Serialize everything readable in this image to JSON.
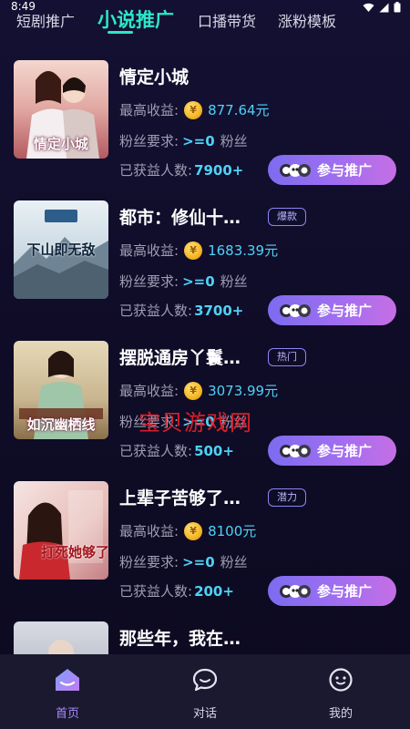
{
  "status_bar": {
    "time": "8:49"
  },
  "top_tabs": [
    {
      "label": "短剧推广",
      "active": false
    },
    {
      "label": "小说推广",
      "active": true
    },
    {
      "label": "口播带货",
      "active": false
    },
    {
      "label": "涨粉模板",
      "active": false
    }
  ],
  "labels": {
    "max_earning": "最高收益:",
    "fans_requirement": "粉丝要求:",
    "fans_unit": "粉丝",
    "earned_count": "已获益人数:",
    "promote_button": "参与推广"
  },
  "books": [
    {
      "title": "情定小城",
      "badge": "",
      "cover_text": "情定小城",
      "max_earning": "877.64元",
      "fans_requirement": ">=0",
      "earned_count": "7900+"
    },
    {
      "title": "都市：修仙十…",
      "badge": "爆款",
      "cover_text": "下山即无敌",
      "max_earning": "1683.39元",
      "fans_requirement": ">=0",
      "earned_count": "3700+"
    },
    {
      "title": "摆脱通房丫鬟…",
      "badge": "热门",
      "cover_text": "如沉幽栖线",
      "max_earning": "3073.99元",
      "fans_requirement": ">=0",
      "earned_count": "500+"
    },
    {
      "title": "上辈子苦够了…",
      "badge": "潜力",
      "cover_text": "打死她够了",
      "max_earning": "8100元",
      "fans_requirement": ">=0",
      "earned_count": "200+"
    },
    {
      "title": "那些年，我在…",
      "badge": "",
      "cover_text": "",
      "max_earning": "",
      "fans_requirement": "",
      "earned_count": ""
    }
  ],
  "watermark": "宝贝游戏网",
  "bottom_nav": [
    {
      "label": "首页",
      "icon": "home-icon",
      "active": true
    },
    {
      "label": "对话",
      "icon": "chat-icon",
      "active": false
    },
    {
      "label": "我的",
      "icon": "profile-icon",
      "active": false
    }
  ],
  "colors": {
    "accent": "#2be8c8",
    "value_blue": "#4fd2f7",
    "button_gradient_start": "#7c6cf0",
    "button_gradient_end": "#c56fe4",
    "background": "#0f0c25"
  }
}
